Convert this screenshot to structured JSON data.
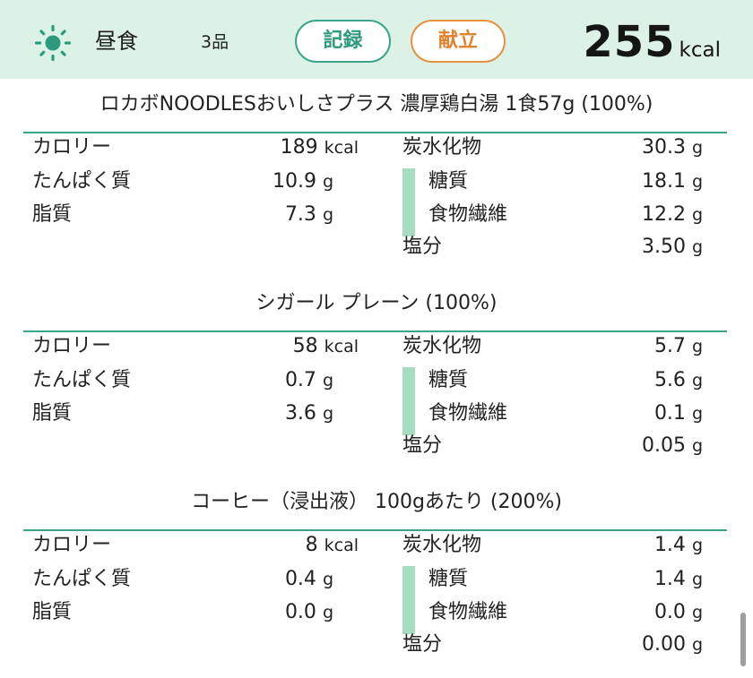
{
  "header": {
    "meal_icon": "sun-icon",
    "meal_name": "昼食",
    "item_count": "3品",
    "record_button": "記録",
    "menu_button": "献立",
    "total_kcal": "255",
    "total_unit": "kcal"
  },
  "colors": {
    "header_bg": "#dcf2e7",
    "accent_green": "#3aa58a",
    "accent_orange": "#e6923e",
    "sugar_bar": "#a6dcbf"
  },
  "foods": [
    {
      "title": "ロカボNOODLESおいしさプラス 濃厚鶏白湯 1食57g (100%)",
      "calories_label": "カロリー",
      "calories": "189",
      "calories_unit": "kcal",
      "protein_label": "たんぱく質",
      "protein": "10.9",
      "protein_unit": "g",
      "fat_label": "脂質",
      "fat": "7.3",
      "fat_unit": "g",
      "carbs_label": "炭水化物",
      "carbs": "30.3",
      "carbs_unit": "g",
      "sugar_label": "糖質",
      "sugar": "18.1",
      "sugar_unit": "g",
      "fiber_label": "食物繊維",
      "fiber": "12.2",
      "fiber_unit": "g",
      "salt_label": "塩分",
      "salt": "3.50",
      "salt_unit": "g"
    },
    {
      "title": "シガール プレーン (100%)",
      "calories_label": "カロリー",
      "calories": "58",
      "calories_unit": "kcal",
      "protein_label": "たんぱく質",
      "protein": "0.7",
      "protein_unit": "g",
      "fat_label": "脂質",
      "fat": "3.6",
      "fat_unit": "g",
      "carbs_label": "炭水化物",
      "carbs": "5.7",
      "carbs_unit": "g",
      "sugar_label": "糖質",
      "sugar": "5.6",
      "sugar_unit": "g",
      "fiber_label": "食物繊維",
      "fiber": "0.1",
      "fiber_unit": "g",
      "salt_label": "塩分",
      "salt": "0.05",
      "salt_unit": "g"
    },
    {
      "title": "コーヒー（浸出液） 100gあたり (200%)",
      "calories_label": "カロリー",
      "calories": "8",
      "calories_unit": "kcal",
      "protein_label": "たんぱく質",
      "protein": "0.4",
      "protein_unit": "g",
      "fat_label": "脂質",
      "fat": "0.0",
      "fat_unit": "g",
      "carbs_label": "炭水化物",
      "carbs": "1.4",
      "carbs_unit": "g",
      "sugar_label": "糖質",
      "sugar": "1.4",
      "sugar_unit": "g",
      "fiber_label": "食物繊維",
      "fiber": "0.0",
      "fiber_unit": "g",
      "salt_label": "塩分",
      "salt": "0.00",
      "salt_unit": "g"
    }
  ]
}
